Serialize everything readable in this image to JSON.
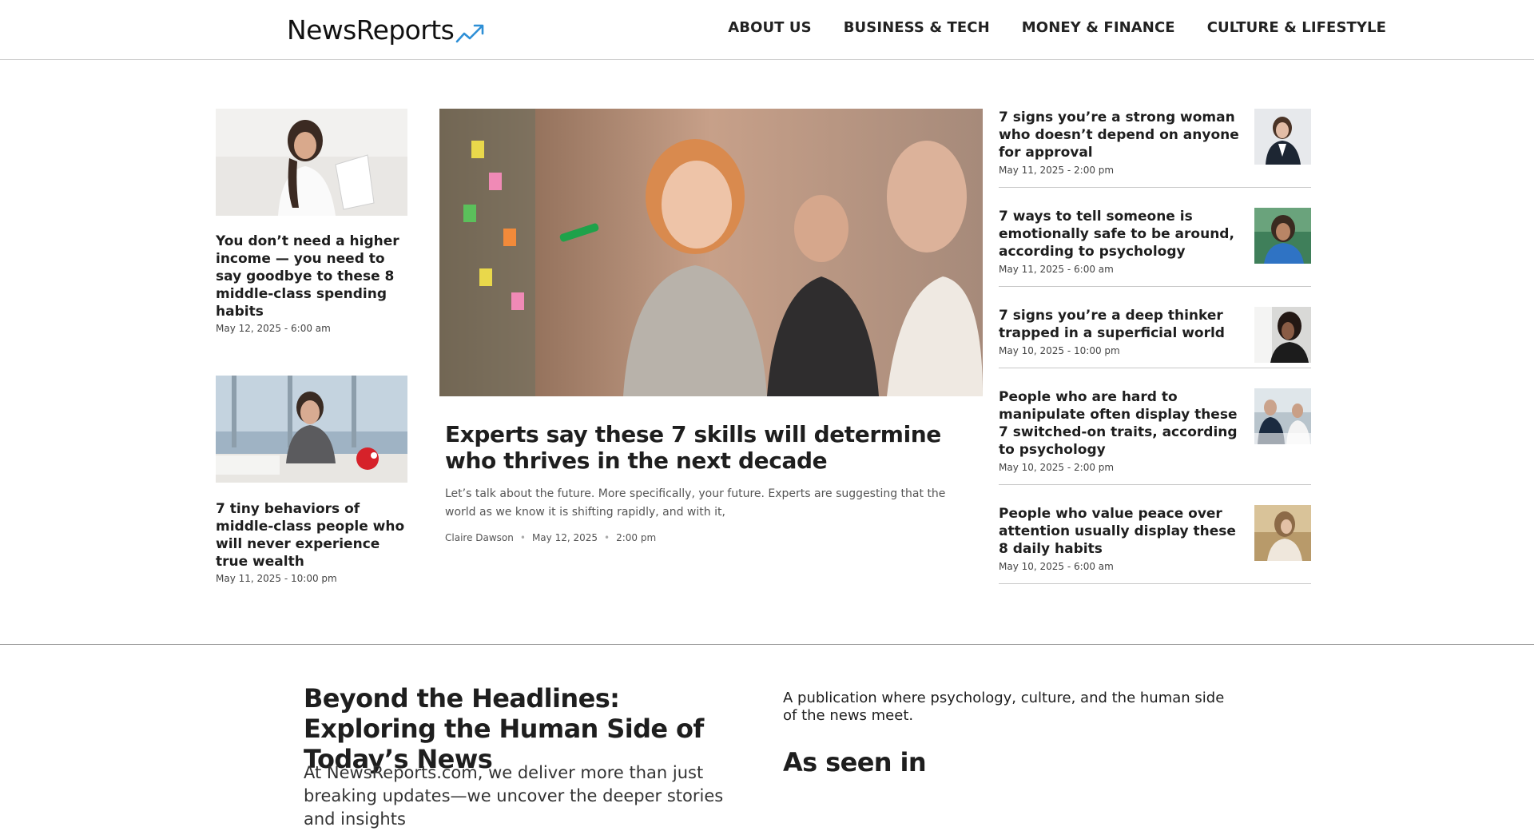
{
  "site": {
    "logo_text": "NewsReports",
    "brand_color": "#2e8fd6"
  },
  "nav": {
    "items": [
      {
        "label": "ABOUT US"
      },
      {
        "label": "BUSINESS & TECH"
      },
      {
        "label": "MONEY & FINANCE"
      },
      {
        "label": "CULTURE & LIFESTYLE"
      }
    ]
  },
  "left_articles": [
    {
      "title": "You don’t need a higher income — you need to say goodbye to these 8 middle-class spending habits",
      "meta": "May 12, 2025 - 6:00 am",
      "image": "woman-reading-paper"
    },
    {
      "title": "7 tiny behaviors of middle-class people who will never experience true wealth",
      "meta": "May 11, 2025 - 10:00 pm",
      "image": "stressed-woman-with-piggy-bank"
    }
  ],
  "featured": {
    "image": "team-brainstorming-sticky-notes",
    "title": "Experts say these 7 skills will determine who thrives in the next decade",
    "excerpt": "Let’s talk about the future. More specifically, your future. Experts are suggesting that the world as we know it is shifting rapidly, and with it,",
    "author": "Claire Dawson",
    "date": "May 12, 2025",
    "time": "2:00 pm"
  },
  "right_articles": [
    {
      "title": "7 signs you’re a strong woman who doesn’t depend on anyone for approval",
      "meta": "May 11, 2025 - 2:00 pm",
      "image": "businesswoman-portrait"
    },
    {
      "title": "7 ways to tell someone is emotionally safe to be around, according to psychology",
      "meta": "May 11, 2025 - 6:00 am",
      "image": "smiling-woman"
    },
    {
      "title": "7 signs you’re a deep thinker trapped in a superficial world",
      "meta": "May 10, 2025 - 10:00 pm",
      "image": "thoughtful-woman"
    },
    {
      "title": "People who are hard to manipulate often display these 7 switched-on traits, according to psychology",
      "meta": "May 10, 2025 - 2:00 pm",
      "image": "business-meeting"
    },
    {
      "title": "People who value peace over attention usually display these 8 daily habits",
      "meta": "May 10, 2025 - 6:00 am",
      "image": "woman-outdoors"
    }
  ],
  "about": {
    "heading": "Beyond the Headlines: Exploring the Human Side of Today’s News",
    "body": "At NewsReports.com, we deliver more than just breaking updates—we uncover the deeper stories and insights",
    "publication_desc": "A publication where psychology, culture, and the human side of the news meet.",
    "seen_in_heading": "As seen in"
  }
}
